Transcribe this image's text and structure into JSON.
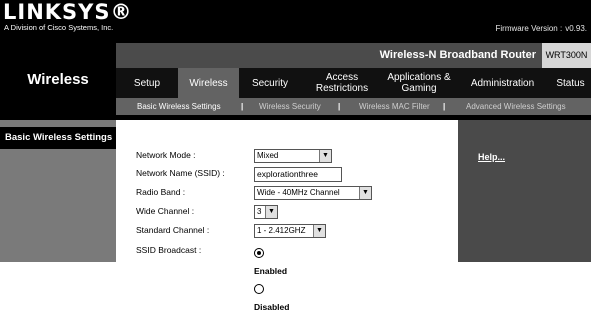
{
  "header": {
    "brand": "LINKSYS®",
    "brand_subtitle": "A Division of Cisco Systems, Inc.",
    "firmware_label": "Firmware Version :",
    "firmware_value": "v0.93."
  },
  "banner": {
    "product_title": "Wireless-N Broadband Router",
    "model": "WRT300N"
  },
  "section": {
    "title": "Wireless"
  },
  "tabs": [
    {
      "label": "Setup",
      "active": false
    },
    {
      "label": "Wireless",
      "active": true
    },
    {
      "label": "Security",
      "active": false
    },
    {
      "label": "Access Restrictions",
      "active": false
    },
    {
      "label": "Applications & Gaming",
      "active": false
    },
    {
      "label": "Administration",
      "active": false
    },
    {
      "label": "Status",
      "active": false
    }
  ],
  "subtabs": [
    {
      "label": "Basic Wireless Settings",
      "active": true
    },
    {
      "label": "Wireless Security",
      "active": false
    },
    {
      "label": "Wireless MAC Filter",
      "active": false
    },
    {
      "label": "Advanced Wireless Settings",
      "active": false
    }
  ],
  "separator": "|",
  "left_panel": {
    "title": "Basic Wireless Settings"
  },
  "right_panel": {
    "help": "Help..."
  },
  "form": {
    "network_mode": {
      "label": "Network Mode :",
      "value": "Mixed"
    },
    "ssid": {
      "label": "Network Name (SSID) :",
      "value": "explorationthree"
    },
    "radio_band": {
      "label": "Radio Band :",
      "value": "Wide - 40MHz Channel"
    },
    "wide_channel": {
      "label": "Wide Channel :",
      "value": "3"
    },
    "standard_channel": {
      "label": "Standard Channel :",
      "value": "1 - 2.412GHZ"
    },
    "ssid_broadcast": {
      "label": "SSID Broadcast :",
      "options": [
        "Enabled",
        "Disabled"
      ],
      "selected": "Enabled"
    }
  },
  "icons": {
    "dropdown": "chevron-down-icon",
    "radio_selected": "radio-selected-icon",
    "radio_unselected": "radio-unselected-icon"
  }
}
